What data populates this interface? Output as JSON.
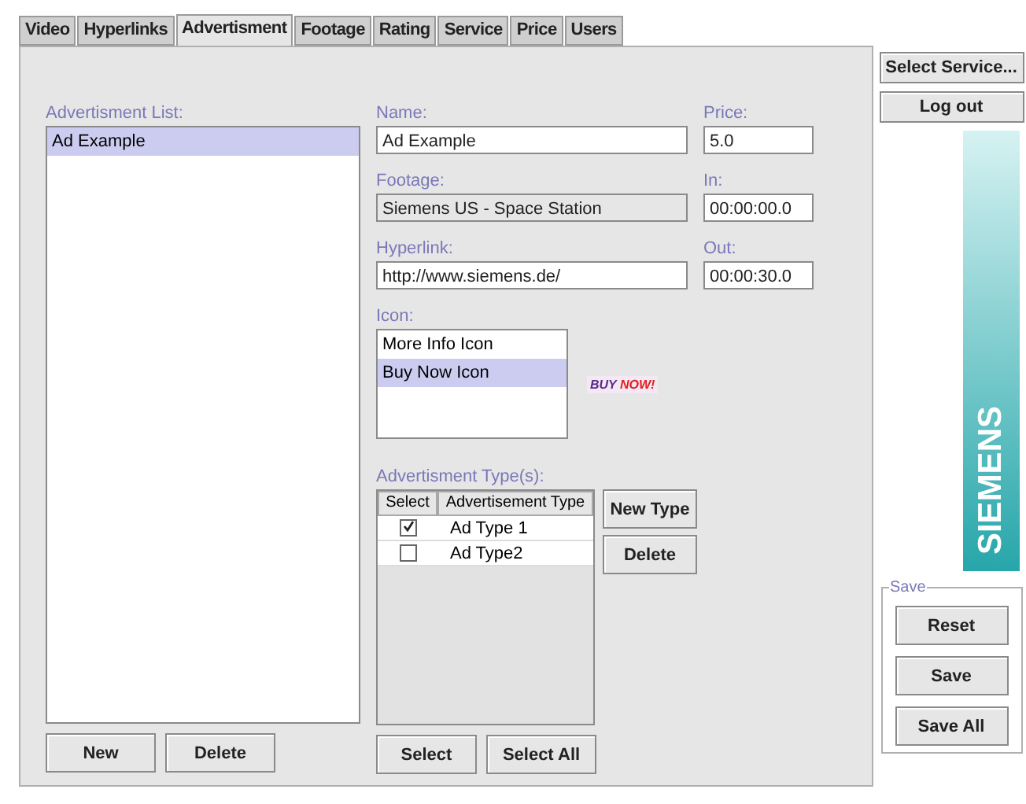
{
  "tabs": [
    {
      "label": "Video",
      "selected": false
    },
    {
      "label": "Hyperlinks",
      "selected": false
    },
    {
      "label": "Advertisment",
      "selected": true
    },
    {
      "label": "Footage",
      "selected": false
    },
    {
      "label": "Rating",
      "selected": false
    },
    {
      "label": "Service",
      "selected": false
    },
    {
      "label": "Price",
      "selected": false
    },
    {
      "label": "Users",
      "selected": false
    }
  ],
  "ad_list": {
    "label": "Advertisment List:",
    "items": [
      {
        "text": "Ad Example",
        "selected": true
      }
    ],
    "buttons": [
      "New",
      "Delete"
    ]
  },
  "name": {
    "label": "Name:",
    "value": "Ad Example"
  },
  "price": {
    "label": "Price:",
    "value": "5.0"
  },
  "footage": {
    "label": "Footage:",
    "value": "Siemens US - Space Station",
    "disabled": true
  },
  "in": {
    "label": "In:",
    "value": "00:00:00.0"
  },
  "hyperlink": {
    "label": "Hyperlink:",
    "value": "http://www.siemens.de/"
  },
  "out": {
    "label": "Out:",
    "value": "00:00:30.0"
  },
  "icon": {
    "label": "Icon:",
    "items": [
      {
        "text": "More Info Icon",
        "selected": false
      },
      {
        "text": "Buy Now Icon",
        "selected": true
      }
    ],
    "preview": [
      "BUY ",
      "NOW!"
    ]
  },
  "types": {
    "label": "Advertisment Type(s):",
    "columns": [
      "Select",
      "Advertisement Type"
    ],
    "rows": [
      {
        "checked": true,
        "name": "Ad Type 1"
      },
      {
        "checked": false,
        "name": "Ad Type2"
      }
    ],
    "side_buttons": [
      "New Type",
      "Delete"
    ],
    "buttons": [
      "Select",
      "Select All"
    ]
  },
  "sidebar": {
    "buttons": [
      "Select Service...",
      "Log out"
    ],
    "logo": "SIEMENS",
    "save_group": {
      "title": "Save",
      "buttons": [
        "Reset",
        "Save",
        "Save All"
      ]
    }
  }
}
